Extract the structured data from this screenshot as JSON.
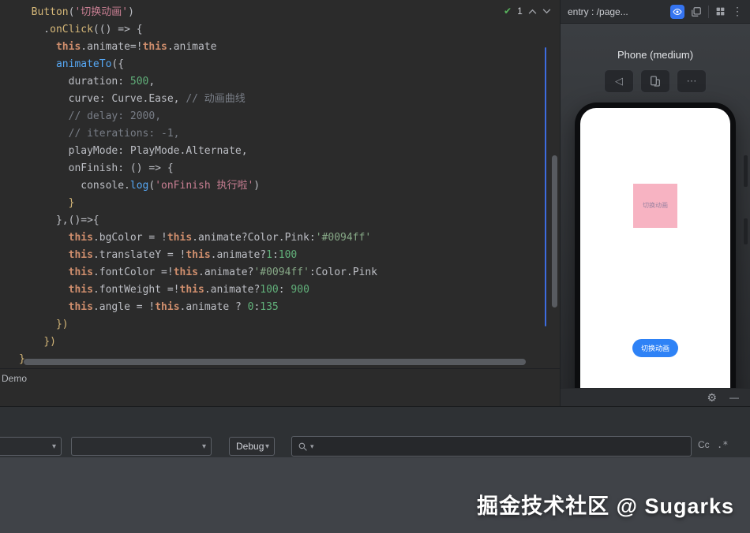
{
  "icons": {
    "check": "✔",
    "kebab": "⋮",
    "more_dots": "⋯",
    "back_triangle": "◁",
    "gear": "⚙",
    "minimize": "—",
    "dropdown_arrow": "▾"
  },
  "editor": {
    "inspection_count": "1",
    "console_tab": "Demo",
    "lines": [
      [
        [
          "  ",
          "p"
        ],
        [
          "Button",
          "fn"
        ],
        [
          "(",
          "p"
        ],
        [
          "'切换动画'",
          "str"
        ],
        [
          ")",
          "p"
        ]
      ],
      [
        [
          "    .",
          "p"
        ],
        [
          "onClick",
          "fn"
        ],
        [
          "(() => {",
          "p"
        ]
      ],
      [
        [
          "      ",
          "p"
        ],
        [
          "this",
          "kw"
        ],
        [
          ".animate=!",
          "p"
        ],
        [
          "this",
          "kw"
        ],
        [
          ".animate",
          "p"
        ]
      ],
      [
        [
          "      ",
          "p"
        ],
        [
          "animateTo",
          "blue"
        ],
        [
          "({",
          "p"
        ]
      ],
      [
        [
          "        duration: ",
          "p"
        ],
        [
          "500",
          "num"
        ],
        [
          ",",
          "p"
        ]
      ],
      [
        [
          "        curve: Curve.Ease, ",
          "p"
        ],
        [
          "// 动画曲线",
          "com"
        ]
      ],
      [
        [
          "        ",
          "p"
        ],
        [
          "// delay: 2000,",
          "com"
        ]
      ],
      [
        [
          "        ",
          "p"
        ],
        [
          "// iterations: -1,",
          "com"
        ]
      ],
      [
        [
          "        playMode: PlayMode.Alternate,",
          "p"
        ]
      ],
      [
        [
          "        onFinish: () => {",
          "p"
        ]
      ],
      [
        [
          "          console.",
          "p"
        ],
        [
          "log",
          "blue"
        ],
        [
          "(",
          "p"
        ],
        [
          "'onFinish 执行啦'",
          "str"
        ],
        [
          ")",
          "p"
        ]
      ],
      [
        [
          "        ",
          "p"
        ],
        [
          "}",
          "brace"
        ]
      ],
      [
        [
          "      },()=>{",
          "p"
        ]
      ],
      [
        [
          "        ",
          "p"
        ],
        [
          "this",
          "kw"
        ],
        [
          ".bgColor = !",
          "p"
        ],
        [
          "this",
          "kw"
        ],
        [
          ".animate?Color.Pink:",
          "p"
        ],
        [
          "'#0094ff'",
          "strhex"
        ]
      ],
      [
        [
          "        ",
          "p"
        ],
        [
          "this",
          "kw"
        ],
        [
          ".translateY = !",
          "p"
        ],
        [
          "this",
          "kw"
        ],
        [
          ".animate?",
          "p"
        ],
        [
          "1",
          "num"
        ],
        [
          ":",
          "p"
        ],
        [
          "100",
          "num"
        ]
      ],
      [
        [
          "        ",
          "p"
        ],
        [
          "this",
          "kw"
        ],
        [
          ".fontColor =!",
          "p"
        ],
        [
          "this",
          "kw"
        ],
        [
          ".animate?",
          "p"
        ],
        [
          "'#0094ff'",
          "strhex"
        ],
        [
          ":Color.Pink",
          "p"
        ]
      ],
      [
        [
          "        ",
          "p"
        ],
        [
          "this",
          "kw"
        ],
        [
          ".fontWeight =!",
          "p"
        ],
        [
          "this",
          "kw"
        ],
        [
          ".animate?",
          "p"
        ],
        [
          "100",
          "num"
        ],
        [
          ": ",
          "p"
        ],
        [
          "900",
          "num"
        ]
      ],
      [
        [
          "        ",
          "p"
        ],
        [
          "this",
          "kw"
        ],
        [
          ".angle = !",
          "p"
        ],
        [
          "this",
          "kw"
        ],
        [
          ".animate ? ",
          "p"
        ],
        [
          "0",
          "num"
        ],
        [
          ":",
          "p"
        ],
        [
          "135",
          "num"
        ]
      ],
      [
        [
          "      ",
          "p"
        ],
        [
          "})",
          "brace"
        ]
      ],
      [
        [
          "    ",
          "p"
        ],
        [
          "})",
          "brace"
        ]
      ],
      [
        [
          "}",
          "brace"
        ]
      ]
    ]
  },
  "previewer": {
    "title": "entry : /page...",
    "device_label": "Phone (medium)",
    "square_label": "切换动画",
    "button_label": "切换动画",
    "accent_blue": "#3574f0",
    "button_color": "#2e82f6",
    "square_color": "#f7b3c2"
  },
  "toolbar": {
    "debug_label": "Debug",
    "match_case": "Cc",
    "regex": ".*"
  },
  "watermark": "掘金技术社区 @ Sugarks"
}
